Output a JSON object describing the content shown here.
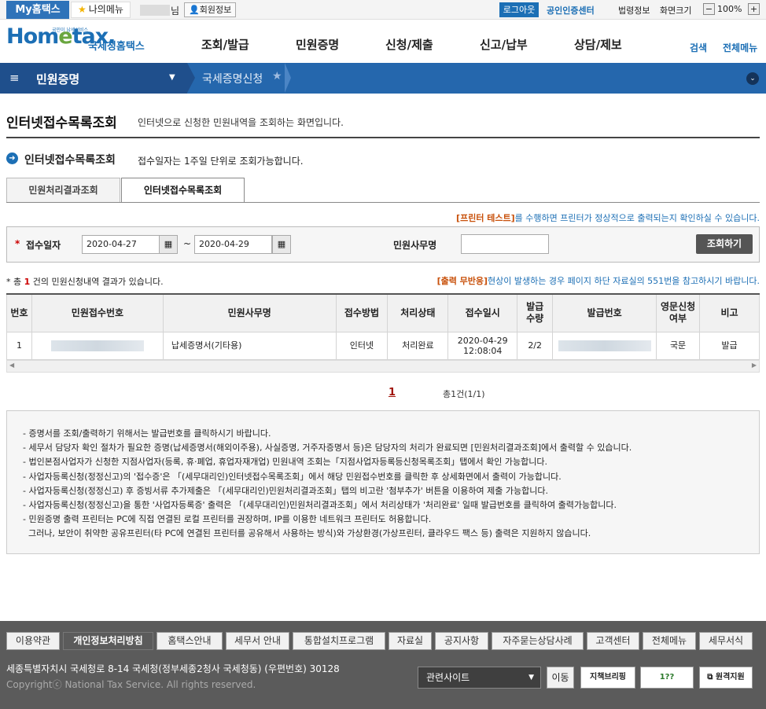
{
  "topbar": {
    "my_hometax": "My홈택스",
    "my_menu": "나의메뉴",
    "name_suffix": "님",
    "member_info": "회원정보",
    "logout": "로그아웃",
    "cert_center": "공인인증센터",
    "law_info": "법령정보",
    "screen_size": "화면크기",
    "zoom_minus": "−",
    "zoom_value": "100%",
    "zoom_plus": "+"
  },
  "header": {
    "logo_text": "Hometax",
    "logo_tiny": "국민이 납세서비스",
    "logo_korean": "국세청홈택스",
    "menus": [
      "조회/발급",
      "민원증명",
      "신청/제출",
      "신고/납부",
      "상담/제보"
    ],
    "search": "검색",
    "all_menu": "전체메뉴"
  },
  "nav": {
    "section": "민원증명",
    "current": "국세증명신청"
  },
  "page": {
    "title": "인터넷접수목록조회",
    "desc": "인터넷으로 신청한 민원내역을 조회하는 화면입니다.",
    "sub_title": "인터넷접수목록조회",
    "sub_desc": "접수일자는 1주일 단위로 조회가능합니다.",
    "tabs": [
      "민원처리결과조회",
      "인터넷접수목록조회"
    ],
    "printer_test_link": "[프린터 테스트]",
    "printer_test_text": "를 수행하면 프린터가 정상적으로 출력되는지 확인하실 수 있습니다."
  },
  "search": {
    "required_mark": "*",
    "date_label": "접수일자",
    "from_date": "2020-04-27",
    "to_date": "2020-04-29",
    "tilde": "~",
    "office_label": "민원사무명",
    "office_value": "",
    "search_button": "조회하기"
  },
  "result": {
    "total_prefix": "* 총 ",
    "total_count": "1",
    "total_suffix": " 건의 민원신청내역 결과가 있습니다.",
    "output_error_link": "[출력 무반응]",
    "output_error_text": "현상이 발생하는 경우 페이지 하단 자료실의 551번을 참고하시기 바랍니다."
  },
  "table": {
    "headers": [
      "번호",
      "민원접수번호",
      "민원사무명",
      "접수방법",
      "처리상태",
      "접수일시",
      "발급\n수량",
      "발급번호",
      "영문신청\n여부",
      "비고"
    ],
    "rows": [
      {
        "no": "1",
        "office": "납세증명서(기타용)",
        "method": "인터넷",
        "status": "처리완료",
        "date": "2020-04-29",
        "time": "12:08:04",
        "qty": "2/2",
        "english": "국문",
        "note": "발급"
      }
    ]
  },
  "pagination": {
    "current": "1",
    "info": "총1건(1/1)"
  },
  "notes": [
    "- 증명서를 조회/출력하기 위해서는 발급번호를 클릭하시기 바랍니다.",
    "- 세무서 담당자 확인 절차가 필요한 증명(납세증명서(해외이주용), 사실증명, 거주자증명서 등)은 담당자의 처리가 완료되면 [민원처리결과조회]에서 출력할 수 있습니다.",
    "- 법인본점사업자가 신청한 지점사업자(등록, 휴·폐업, 휴업자재개업) 민원내역 조회는「지점사업자등록등신청목록조회」탭에서 확인 가능합니다.",
    "- 사업자등록신청(정정신고)의 '접수증'은 「(세무대리인)인터넷접수목록조회」에서 해당 민원접수번호를 클릭한 후 상세화면에서 출력이 가능합니다.",
    "- 사업자등록신청(정정신고) 후 증빙서류 추가제출은 「(세무대리인)민원처리결과조회」탭의 비고란 '첨부추가' 버튼을 이용하여 제출 가능합니다.",
    "- 사업자등록신청(정정신고)을 통한 '사업자등록증' 출력은  「(세무대리인)민원처리결과조회」에서 처리상태가 '처리완료' 일때 발급번호를 클릭하여 출력가능합니다.",
    "- 민원증명 출력 프린터는 PC에 직접 연결된 로컬 프린터를 권장하며, IP를 이용한 네트워크 프린터도 허용합니다.",
    "  그러나, 보안이 취약한 공유프린터(타 PC에 연결된 프린터를 공유해서 사용하는 방식)와 가상환경(가상프린터, 클라우드 팩스 등) 출력은 지원하지 않습니다."
  ],
  "footer": {
    "links": [
      "이용약관",
      "개인정보처리방침",
      "홈택스안내",
      "세무서 안내",
      "통합설치프로그램",
      "자료실",
      "공지사항",
      "자주묻는상담사례",
      "고객센터",
      "전체메뉴",
      "세무서식"
    ],
    "address": "세종특별자치시 국세청로 8-14 국세청(정부세종2청사 국세청동) (우편번호) 30128",
    "copyright": "Copyrightⓒ National Tax Service. All rights reserved.",
    "related_sites": "관련사이트",
    "move": "이동",
    "badge1": "지책브리핑",
    "badge2": "1??",
    "remote": "원격지원"
  }
}
